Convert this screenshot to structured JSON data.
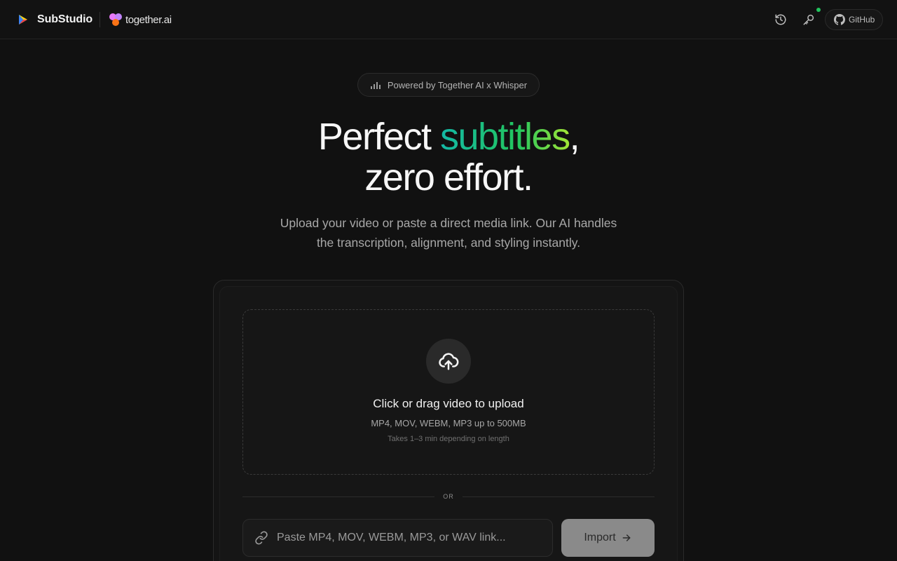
{
  "header": {
    "brand_name": "SubStudio",
    "partner_name": "together.ai",
    "github_label": "GitHub",
    "history_icon": "history-icon",
    "key_icon": "key-icon",
    "status_color": "#22c55e"
  },
  "hero": {
    "badge_text": "Powered by Together AI x Whisper",
    "headline_part1": "Perfect ",
    "headline_highlight": "subtitles",
    "headline_part2": ",",
    "headline_line2": "zero effort.",
    "subtext_line1": "Upload your video or paste a direct media link. Our AI handles",
    "subtext_line2": "the transcription, alignment, and styling instantly.",
    "highlight_gradient": [
      "#14b8a6",
      "#22c55e",
      "#a3e635"
    ]
  },
  "upload": {
    "title": "Click or drag video to upload",
    "formats": "MP4, MOV, WEBM, MP3 up to 500MB",
    "note": "Takes 1–3 min depending on length",
    "icon": "cloud-upload-icon"
  },
  "divider": {
    "label": "OR"
  },
  "link": {
    "placeholder": "Paste MP4, MOV, WEBM, MP3, or WAV link...",
    "value": "",
    "icon": "link-icon"
  },
  "import_button": {
    "label": "Import",
    "icon": "arrow-right-icon"
  }
}
